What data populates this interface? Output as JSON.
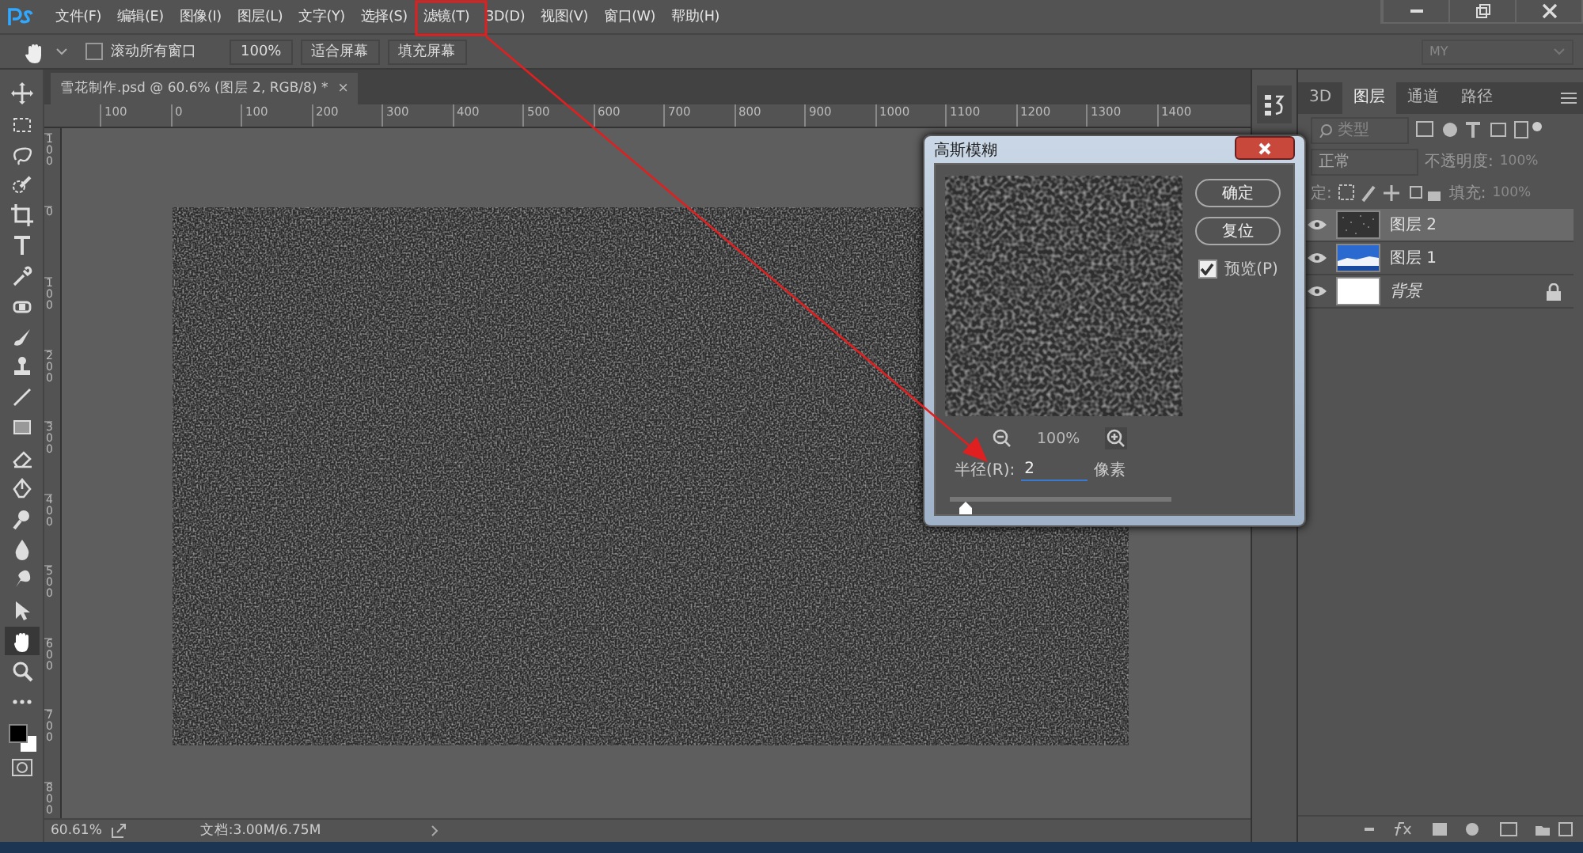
{
  "menu": [
    "文件(F)",
    "编辑(E)",
    "图像(I)",
    "图层(L)",
    "文字(Y)",
    "选择(S)",
    "滤镜(T)",
    "3D(D)",
    "视图(V)",
    "窗口(W)",
    "帮助(H)"
  ],
  "options_bar": {
    "scroll_all": {
      "label": "滚动所有窗口",
      "checked": false
    },
    "buttons": [
      "100%",
      "适合屏幕",
      "填充屏幕"
    ],
    "workspace": "MY"
  },
  "document_tab": {
    "title": "雪花制作.psd @ 60.6% (图层 2, RGB/8) *",
    "close": "×"
  },
  "ruler": {
    "horizontal": [
      "100",
      "0",
      "100",
      "200",
      "300",
      "400",
      "500",
      "600",
      "700",
      "800",
      "900",
      "1000",
      "1100",
      "1200",
      "1300",
      "1400"
    ],
    "vertical": [
      "100",
      "0",
      "100",
      "200",
      "300",
      "400",
      "500",
      "600",
      "700",
      "800"
    ]
  },
  "tools": [
    {
      "kind": "move",
      "selected": false
    },
    {
      "kind": "marquee",
      "selected": false
    },
    {
      "kind": "lasso",
      "selected": false
    },
    {
      "kind": "quick-select",
      "selected": false
    },
    {
      "kind": "crop",
      "selected": false
    },
    {
      "kind": "type",
      "selected": false
    },
    {
      "kind": "eyedropper",
      "selected": false
    },
    {
      "kind": "healing",
      "selected": false
    },
    {
      "kind": "brush",
      "selected": false
    },
    {
      "kind": "stamp",
      "selected": false
    },
    {
      "kind": "line",
      "selected": false
    },
    {
      "kind": "gradient",
      "selected": false
    },
    {
      "kind": "eraser",
      "selected": false
    },
    {
      "kind": "pen",
      "selected": false
    },
    {
      "kind": "dodge",
      "selected": false
    },
    {
      "kind": "blur",
      "selected": false
    },
    {
      "kind": "smudge",
      "selected": false
    },
    {
      "kind": "path-select",
      "selected": false
    },
    {
      "kind": "hand",
      "selected": true
    },
    {
      "kind": "zoom",
      "selected": false
    },
    {
      "kind": "more",
      "selected": false
    }
  ],
  "status_bar": {
    "zoom": "60.61%",
    "document": "文档:3.00M/6.75M"
  },
  "dialog": {
    "title": "高斯模糊",
    "buttons": [
      "确定",
      "复位"
    ],
    "preview": {
      "label": "预览(P)",
      "checked": true
    },
    "zoom": "100%",
    "radius": {
      "label": "半径(R):",
      "value": "2",
      "unit": "像素",
      "level": 0.04
    }
  },
  "layers_panel": {
    "tabs": [
      {
        "label": "3D",
        "selected": false
      },
      {
        "label": "图层",
        "selected": true
      },
      {
        "label": "通道",
        "selected": false
      },
      {
        "label": "路径",
        "selected": false
      }
    ],
    "filter": {
      "placeholder": "类型"
    },
    "blend_mode": "正常",
    "opacity": {
      "label": "不透明度:",
      "value": "100%"
    },
    "lock_label": "定:",
    "fill": {
      "label": "填充:",
      "value": "100%"
    },
    "layers": [
      {
        "name": "图层 2",
        "kind": "noise",
        "selected": true,
        "visible": true
      },
      {
        "name": "图层 1",
        "selected": false,
        "visible": true
      },
      {
        "name": "背景",
        "kind": "background",
        "selected": false,
        "visible": true
      }
    ]
  }
}
